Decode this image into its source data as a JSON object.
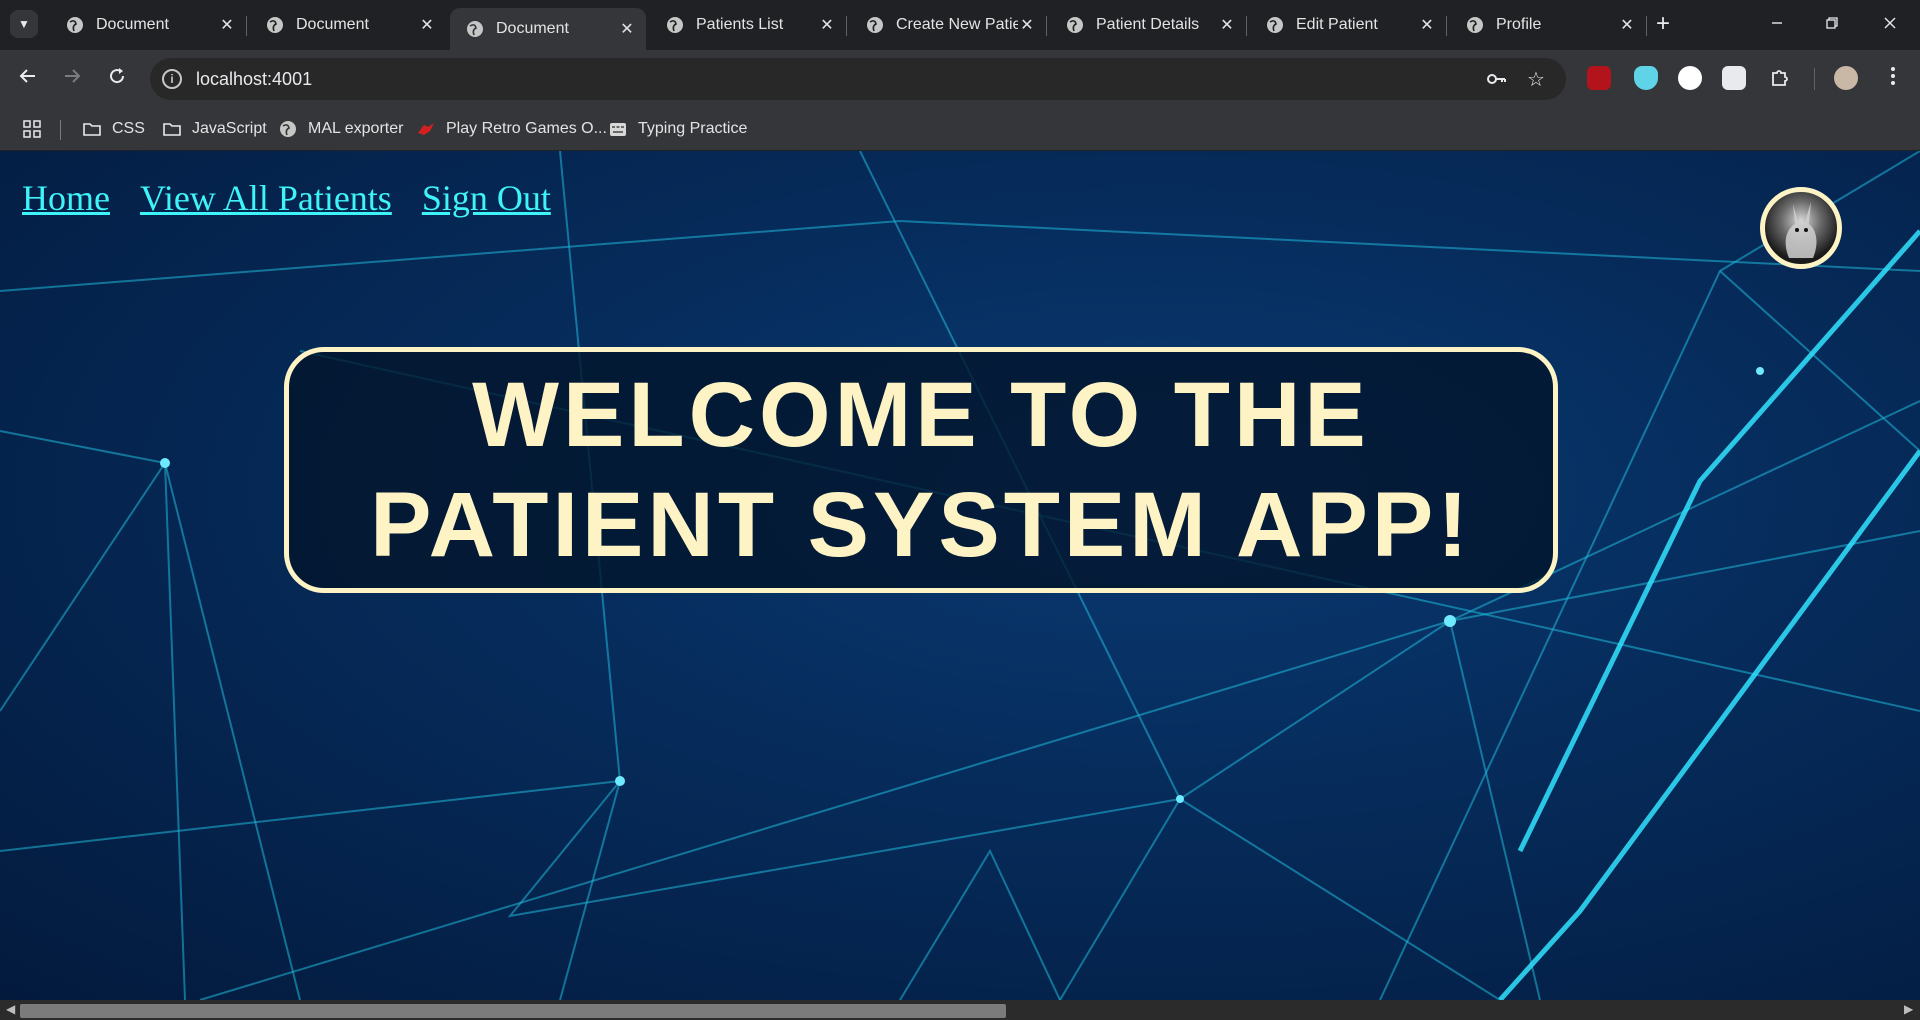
{
  "browser": {
    "tabs": [
      {
        "title": "Document",
        "active": false
      },
      {
        "title": "Document",
        "active": false
      },
      {
        "title": "Document",
        "active": true
      },
      {
        "title": "Patients List",
        "active": false
      },
      {
        "title": "Create New Patie",
        "active": false
      },
      {
        "title": "Patient Details",
        "active": false
      },
      {
        "title": "Edit Patient",
        "active": false
      },
      {
        "title": "Profile",
        "active": false
      }
    ],
    "tab_close_glyph": "✕",
    "new_tab_glyph": "+",
    "url": "localhost:4001",
    "bookmarks": [
      {
        "label": "CSS",
        "icon": "folder-icon"
      },
      {
        "label": "JavaScript",
        "icon": "folder-icon"
      },
      {
        "label": "MAL exporter",
        "icon": "globe-icon"
      },
      {
        "label": "Play Retro Games O...",
        "icon": "game-icon"
      },
      {
        "label": "Typing Practice",
        "icon": "keyboard-icon"
      }
    ],
    "colors": {
      "tabstrip": "#202124",
      "toolbar": "#35363a",
      "omnibox": "#282828"
    }
  },
  "page": {
    "nav": {
      "home": "Home",
      "view_all": "View All Patients",
      "sign_out": "Sign Out"
    },
    "welcome_line1": "WELCOME TO THE",
    "welcome_line2": "PATIENT SYSTEM APP!",
    "colors": {
      "link": "#3ff4f9",
      "accent_cream": "#fdf3c4",
      "background": "#062c5c"
    }
  }
}
